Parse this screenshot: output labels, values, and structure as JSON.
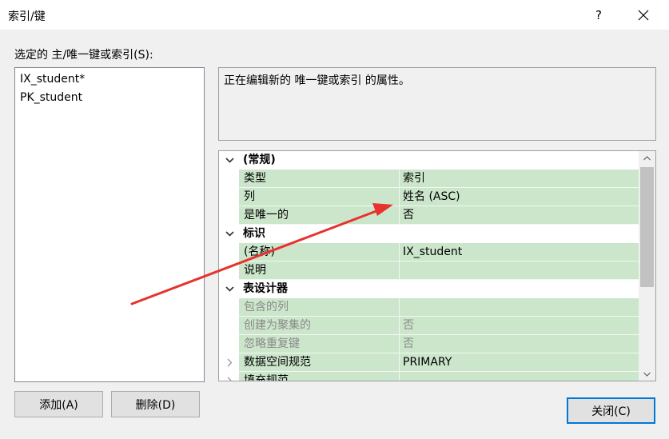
{
  "window": {
    "title": "索引/键",
    "help_label": "?"
  },
  "left_panel": {
    "caption": "选定的 主/唯一键或索引(S):",
    "items": [
      "IX_student*",
      "PK_student"
    ]
  },
  "description": "正在编辑新的 唯一键或索引 的属性。",
  "property_grid": {
    "rows": [
      {
        "kind": "category",
        "label": "(常规)",
        "expanded": true
      },
      {
        "kind": "property",
        "name": "类型",
        "value": "索引"
      },
      {
        "kind": "property",
        "name": "列",
        "value": "姓名 (ASC)"
      },
      {
        "kind": "property",
        "name": "是唯一的",
        "value": "否"
      },
      {
        "kind": "category",
        "label": "标识",
        "expanded": true
      },
      {
        "kind": "property",
        "name": "(名称)",
        "value": "IX_student"
      },
      {
        "kind": "property",
        "name": "说明",
        "value": ""
      },
      {
        "kind": "category",
        "label": "表设计器",
        "expanded": true
      },
      {
        "kind": "property",
        "name": "包含的列",
        "value": "",
        "disabled": true
      },
      {
        "kind": "property",
        "name": "创建为聚集的",
        "value": "否",
        "disabled": true
      },
      {
        "kind": "property",
        "name": "忽略重复键",
        "value": "否",
        "disabled": true
      },
      {
        "kind": "property",
        "name": "数据空间规范",
        "value": "PRIMARY",
        "expandable": true
      },
      {
        "kind": "property",
        "name": "填充规范",
        "value": "",
        "expandable": true
      }
    ]
  },
  "buttons": {
    "add": "添加(A)",
    "delete": "删除(D)",
    "close": "关闭(C)"
  },
  "colors": {
    "row_bg": "#cbe6cb",
    "annotation_arrow": "#e8322e",
    "focus_border": "#0078d7"
  }
}
